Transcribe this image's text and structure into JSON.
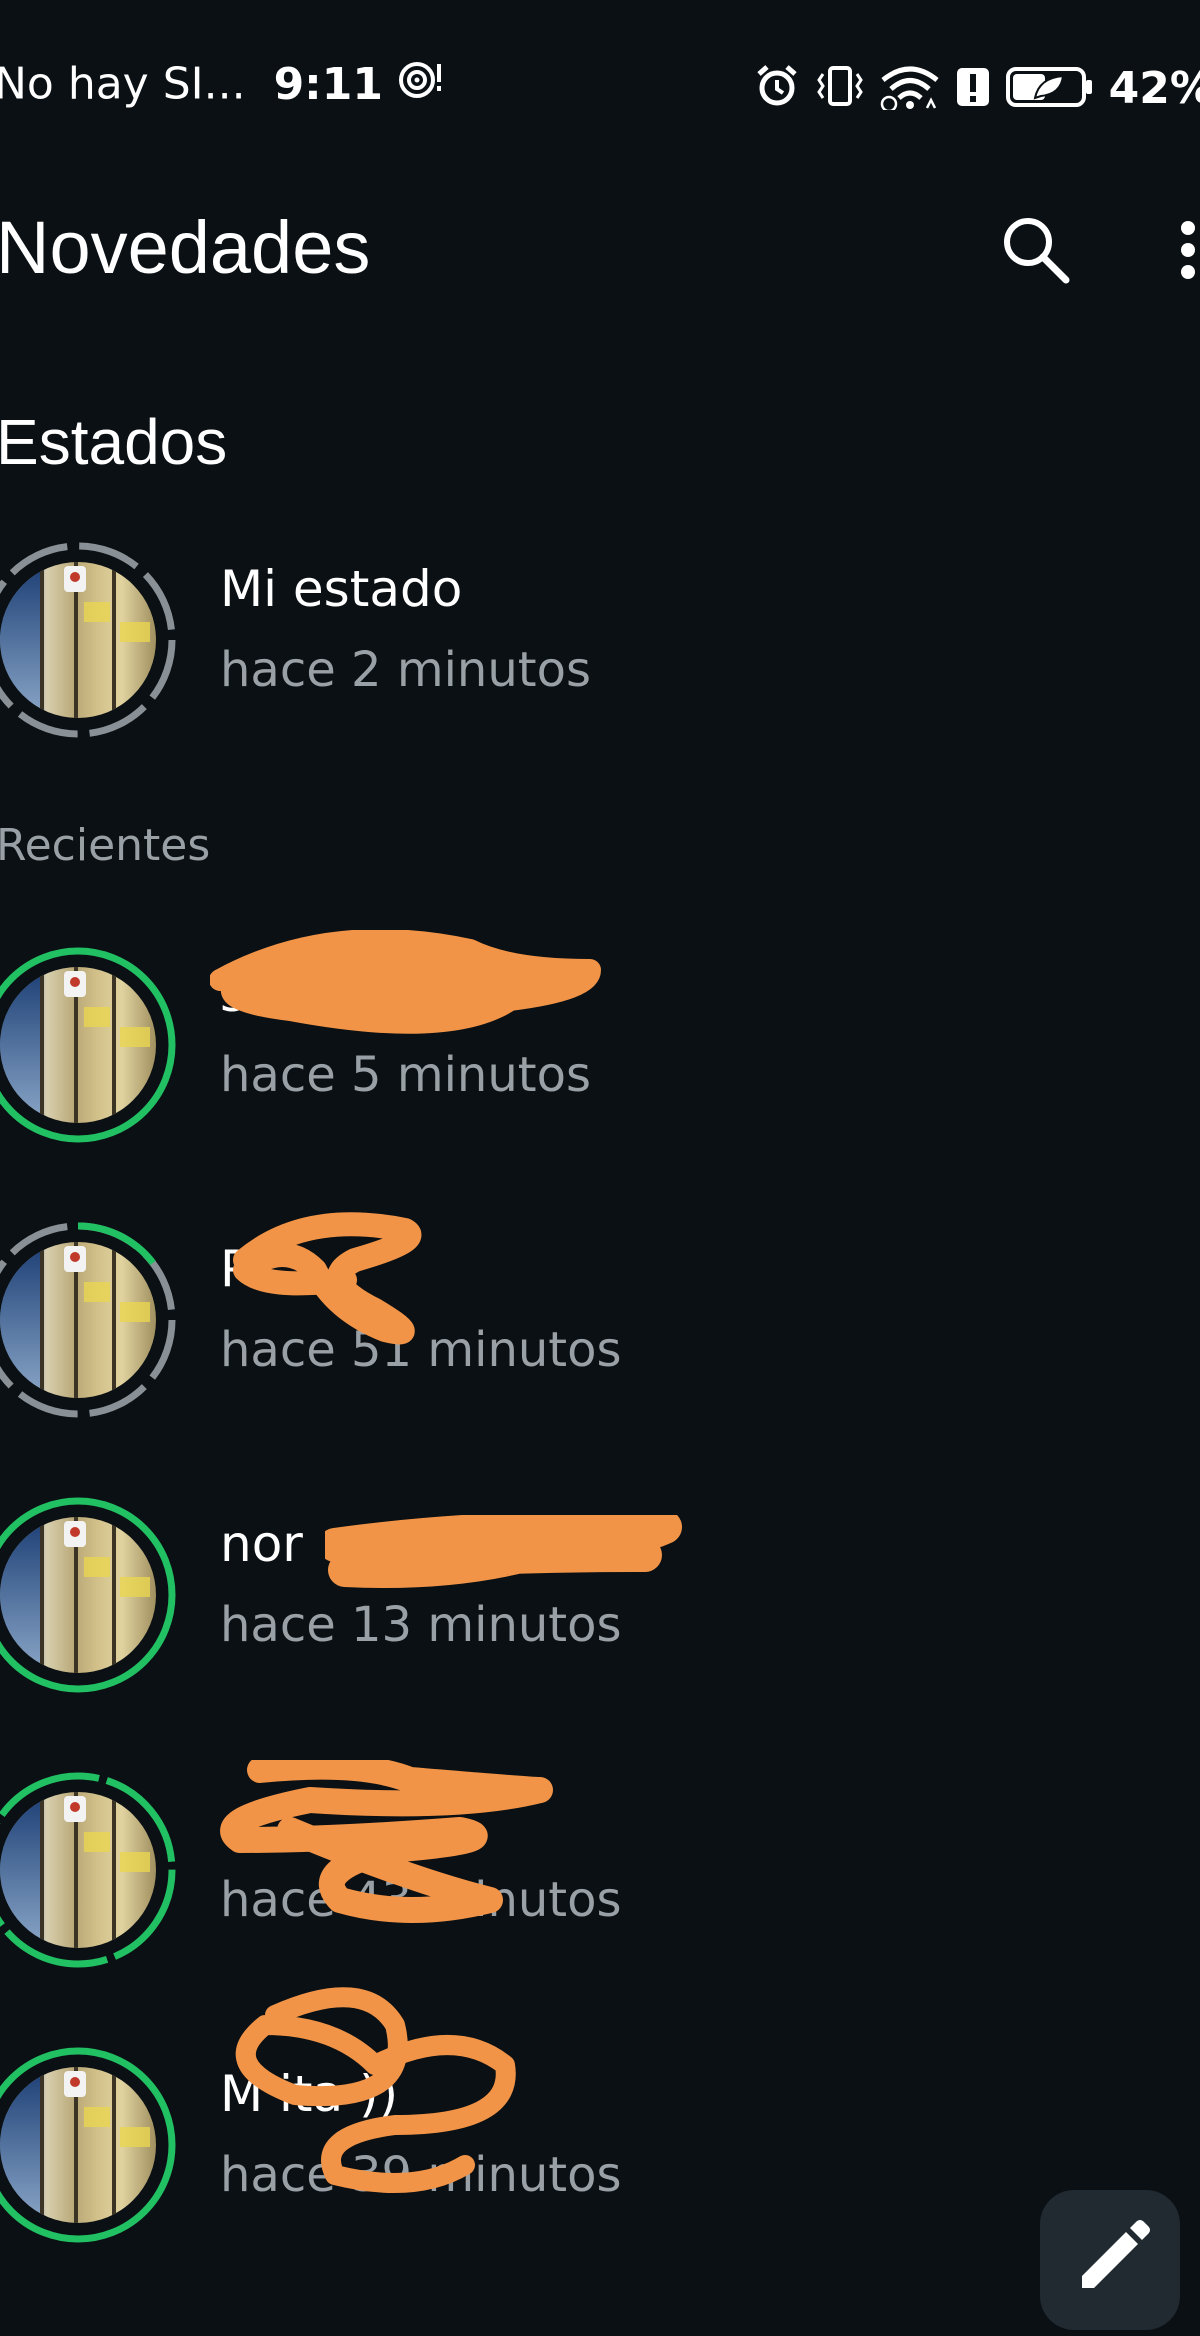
{
  "status_bar": {
    "carrier": "No hay SI...",
    "time": "9:11",
    "battery": "42%",
    "icons": [
      "hotspot-icon",
      "alarm-icon",
      "vibrate-icon",
      "wifi-icon",
      "alert-icon",
      "battery-saver-icon"
    ]
  },
  "app_bar": {
    "title": "Novedades",
    "icons": [
      "search-icon",
      "more-vert-icon"
    ]
  },
  "section": {
    "title": "Estados",
    "recent_label": "Recientes"
  },
  "my_status": {
    "name": "Mi estado",
    "time": "hace 2 minutos"
  },
  "recent": [
    {
      "name": "sa",
      "time": "hace 5 minutos"
    },
    {
      "name": "P",
      "time": "hace 51 minutos"
    },
    {
      "name": "nor",
      "time": "hace 13 minutos"
    },
    {
      "name": "",
      "time": "hace 43 minutos"
    },
    {
      "name": "M ita ))",
      "time": "hace 39 minutos"
    }
  ],
  "fab": {
    "icon": "pencil-icon"
  },
  "colors": {
    "background": "#0b1014",
    "seen_ring": "#8a9196",
    "unseen_ring": "#21c063",
    "secondary_text": "#9aa1a6",
    "redaction": "#f29447",
    "fab_bg": "#202a30"
  }
}
